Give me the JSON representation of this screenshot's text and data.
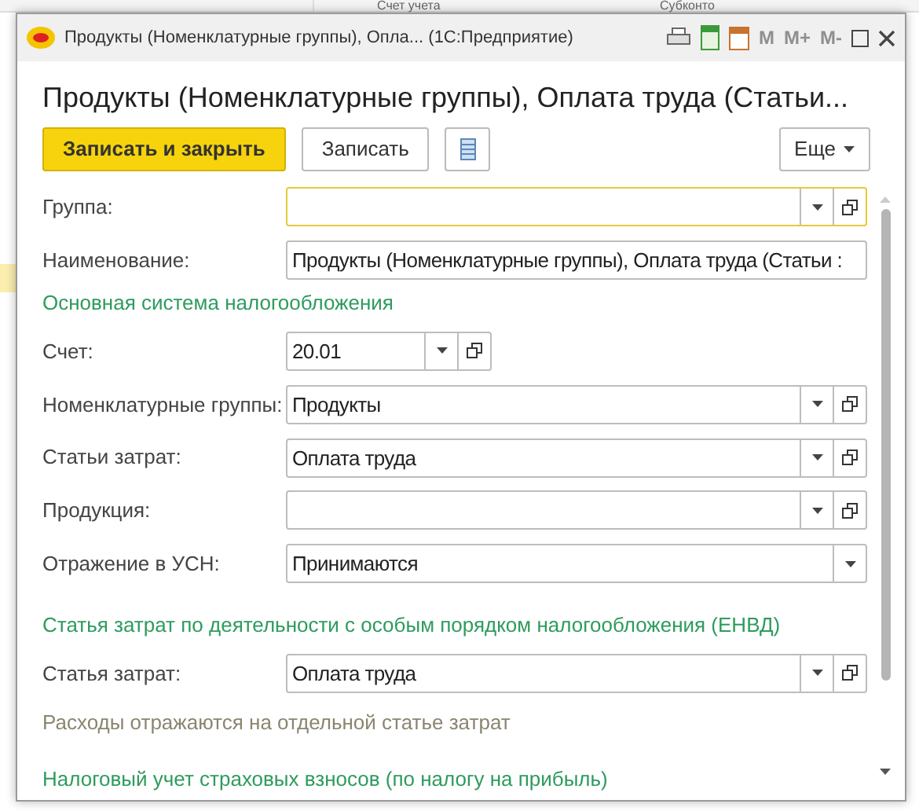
{
  "background": {
    "columns": [
      "Счет учета",
      "Субконто"
    ]
  },
  "window": {
    "title": "Продукты  (Номенклатурные группы), Опла...  (1С:Предприятие)",
    "memory_buttons": [
      "M",
      "M+",
      "M-"
    ]
  },
  "heading": "Продукты  (Номенклатурные группы), Оплата труда (Статьи...",
  "toolbar": {
    "primary": "Записать и закрыть",
    "secondary": "Записать",
    "more": "Еще"
  },
  "form": [
    {
      "kind": "field",
      "label": "Группа:",
      "focused": true,
      "dropdown": true,
      "open_button": true,
      "short": false
    },
    {
      "kind": "field",
      "label": "Наименование:",
      "value": "Продукты  (Номенклатурные группы), Оплата труда (Статьи :",
      "focused": false,
      "dropdown": false,
      "open_button": false,
      "short": false
    },
    {
      "kind": "section",
      "text": "Основная система налогообложения"
    },
    {
      "kind": "field",
      "label": "Счет:",
      "value": "20.01",
      "focused": false,
      "dropdown": true,
      "open_button": true,
      "short": true
    },
    {
      "kind": "field",
      "label": "Номенклатурные группы:",
      "value": "Продукты",
      "focused": false,
      "dropdown": true,
      "open_button": true,
      "short": false
    },
    {
      "kind": "field",
      "label": "Статьи затрат:",
      "value": "Оплата труда",
      "focused": false,
      "dropdown": true,
      "open_button": true,
      "short": false
    },
    {
      "kind": "field",
      "label": "Продукция:",
      "focused": false,
      "dropdown": true,
      "open_button": true,
      "short": false
    },
    {
      "kind": "field",
      "label": "Отражение в УСН:",
      "value": "Принимаются",
      "focused": false,
      "dropdown": true,
      "open_button": false,
      "short": false
    },
    {
      "kind": "section",
      "text": "Статья затрат по деятельности с особым порядком налогообложения (ЕНВД)"
    },
    {
      "kind": "field",
      "label": "Статья затрат:",
      "value": "Оплата труда",
      "focused": false,
      "dropdown": true,
      "open_button": true,
      "short": false
    },
    {
      "kind": "note",
      "text": "Расходы отражаются на отдельной статье затрат"
    },
    {
      "kind": "section",
      "text": "Налоговый учет страховых взносов (по налогу на прибыль)"
    }
  ]
}
